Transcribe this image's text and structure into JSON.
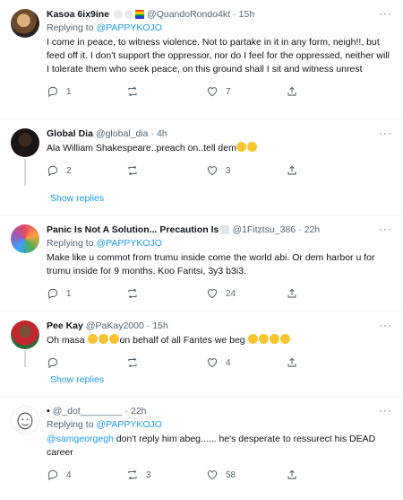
{
  "tweets": [
    {
      "name": "Kasoa 6ix9ine",
      "handle": "@QuandoRondo4kt",
      "time": "15h",
      "replying_prefix": "Replying to ",
      "replying_to": "@PAPPYKOJO",
      "text": "I come in peace, to witness violence. Not to partake in it in any form, neigh!!, but feed off it. I don't support the oppressor, nor do I feel for the oppressed, neither will I tolerate them who seek peace, on this ground shall I sit and witness unrest",
      "replies": "1",
      "retweets": "",
      "likes": "7"
    },
    {
      "name": "Global Dia",
      "handle": "@global_dia",
      "time": "4h",
      "text": "Ala William Shakespeare..preach on..tell dem",
      "replies": "2",
      "retweets": "",
      "likes": "3",
      "show_replies": "Show replies"
    },
    {
      "name": "Panic Is Not A Solution... Precaution Is",
      "handle": "@1Fitztsu_386",
      "time": "22h",
      "replying_prefix": "Replying to ",
      "replying_to": "@PAPPYKOJO",
      "text": "Make like u commot from trumu inside come the world abi. Or dem harbor u for trumu inside for 9 months. Koo Fantsi, 3y3 b3i3.",
      "replies": "1",
      "retweets": "",
      "likes": "24"
    },
    {
      "name": "Pee Kay",
      "handle": "@PaKay2000",
      "time": "15h",
      "text_a": "Oh masa",
      "text_b": "on behalf of all Fantes we beg",
      "replies": "",
      "retweets": "",
      "likes": "4",
      "show_replies": "Show replies"
    },
    {
      "name": "•",
      "handle": "@_dot________",
      "time": "22h",
      "replying_prefix": "Replying to ",
      "replying_to": "@PAPPYKOJO",
      "text_mention": "@samgeorgegh",
      "text": " don't reply him abeg...... he's desperate to ressurect his DEAD career",
      "replies": "4",
      "retweets": "3",
      "likes": "58"
    }
  ],
  "separator_dot": "·",
  "more_glyph": "···",
  "icons": [
    "reply-icon",
    "retweet-icon",
    "like-icon",
    "share-icon",
    "more-icon"
  ],
  "colors": {
    "link": "#1d9bf0",
    "muted": "#536471",
    "text": "#0f1419",
    "divider": "#eff3f4"
  }
}
